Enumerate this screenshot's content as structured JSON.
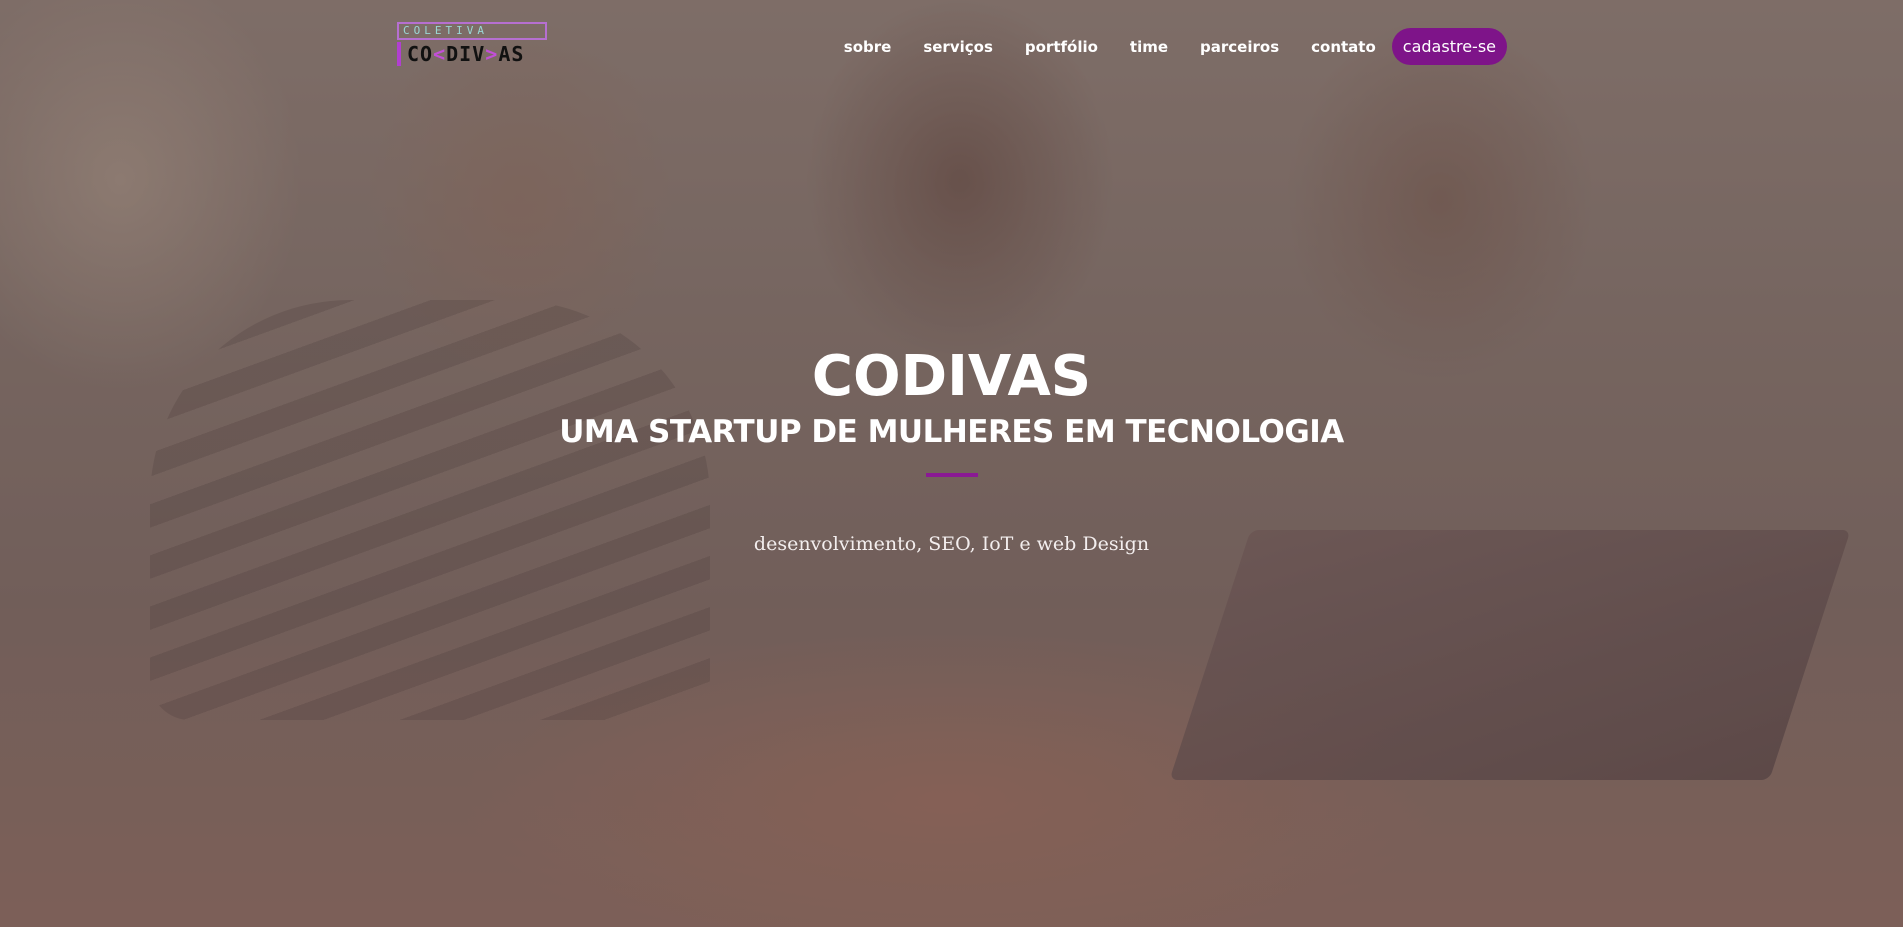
{
  "header": {
    "logo": {
      "top_text": "COLETIVA",
      "main_prefix": "CO",
      "main_bracket_left": "<",
      "main_middle": "DIV",
      "main_bracket_right": ">",
      "main_suffix": "AS"
    },
    "nav": {
      "items": [
        {
          "label": "sobre"
        },
        {
          "label": "serviços"
        },
        {
          "label": "portfólio"
        },
        {
          "label": "time"
        },
        {
          "label": "parceiros"
        },
        {
          "label": "contato"
        }
      ],
      "cta_label": "cadastre-se"
    }
  },
  "hero": {
    "title": "CODIVAS",
    "subtitle": "UMA STARTUP DE MULHERES EM TECNOLOGIA",
    "tagline": "desenvolvimento, SEO, IoT e web Design"
  },
  "colors": {
    "accent": "#7e1489",
    "divider": "#8a1a94",
    "text": "#ffffff"
  }
}
